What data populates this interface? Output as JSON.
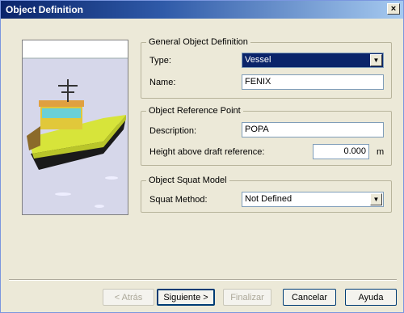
{
  "window": {
    "title": "Object Definition",
    "close_glyph": "×"
  },
  "preview": {
    "description_icon": "vessel-3d-preview"
  },
  "general": {
    "legend": "General Object Definition",
    "type_label": "Type:",
    "type_value": "Vessel",
    "name_label": "Name:",
    "name_value": "FENIX"
  },
  "reference": {
    "legend": "Object Reference Point",
    "description_label": "Description:",
    "description_value": "POPA",
    "height_label": "Height above draft reference:",
    "height_value": "0.000",
    "height_unit": "m"
  },
  "squat": {
    "legend": "Object Squat Model",
    "method_label": "Squat Method:",
    "method_value": "Not Defined"
  },
  "buttons": {
    "back": "< Atrás",
    "next": "Siguiente >",
    "finish": "Finalizar",
    "cancel": "Cancelar",
    "help": "Ayuda"
  }
}
